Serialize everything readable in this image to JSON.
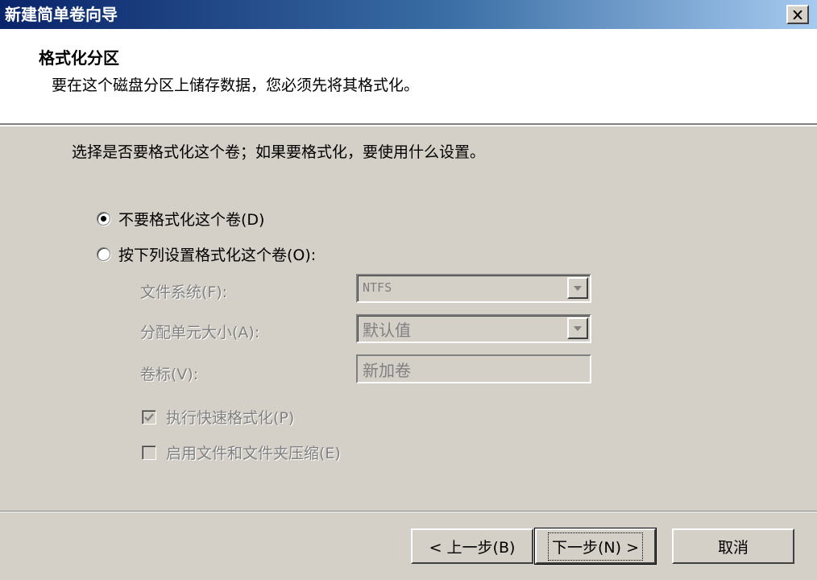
{
  "window": {
    "title": "新建简单卷向导",
    "close_label": "×"
  },
  "header": {
    "title": "格式化分区",
    "subtitle": "要在这个磁盘分区上储存数据，您必须先将其格式化。"
  },
  "body": {
    "prompt": "选择是否要格式化这个卷；如果要格式化，要使用什么设置。",
    "options": [
      {
        "label": "不要格式化这个卷(D)",
        "checked": true
      },
      {
        "label": "按下列设置格式化这个卷(O):",
        "checked": false
      }
    ],
    "fields": {
      "filesystem_label": "文件系统(F):",
      "filesystem_value": "NTFS",
      "allocation_label": "分配单元大小(A):",
      "allocation_value": "默认值",
      "volume_label_label": "卷标(V):",
      "volume_label_value": "新加卷"
    },
    "checks": [
      {
        "label": "执行快速格式化(P)",
        "checked": true
      },
      {
        "label": "启用文件和文件夹压缩(E)",
        "checked": false
      }
    ]
  },
  "footer": {
    "back_label": "< 上一步(B)",
    "next_label": "下一步(N) >",
    "cancel_label": "取消"
  }
}
